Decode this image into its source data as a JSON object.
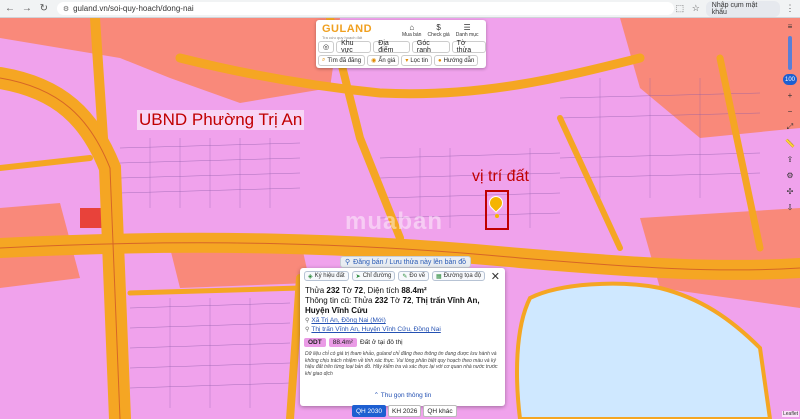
{
  "browser": {
    "url": "guland.vn/soi-quy-hoach/dong-nai",
    "translate_label": "Nhập cụm mật khẩu"
  },
  "app": {
    "logo": "GULAND",
    "logo_tagline": "Tra cứu quy hoạch đất",
    "top_tools": [
      {
        "label": "Mua bán",
        "icon": "home-icon"
      },
      {
        "label": "Check giá",
        "icon": "dollar-icon"
      },
      {
        "label": "Danh mục",
        "icon": "menu-icon"
      }
    ],
    "tabs": [
      "Khu vực",
      "Địa điểm",
      "Góc ranh",
      "Tờ thửa"
    ],
    "filters": [
      "Tìm đã đăng",
      "Ẩn giá",
      "Lọc tin",
      "Hướng dẫn"
    ]
  },
  "map": {
    "label_ubnd": "UBND Phường Trị An",
    "label_location": "vị trí đất",
    "watermark": "muaban",
    "zoom_badge": "100",
    "draw_button": "Đăng bán / Lưu thửa này lên bản đồ",
    "colors": {
      "residential": "#f0a2ec",
      "road": "#f5a623",
      "public": "#f9897a",
      "water": "#cfe8ff"
    }
  },
  "info": {
    "chips": [
      "Ký hiệu đất",
      "Chỉ đường",
      "Đo vẽ",
      "Đường tọa độ"
    ],
    "thua_label": "Thửa",
    "thua_value": "232",
    "to_label": "Tờ",
    "to_value": "72",
    "area_label": "Diện tích",
    "area_value": "88.4m²",
    "old_info_prefix": "Thông tin cũ: Thửa",
    "old_thua": "232",
    "old_to_label": "Tờ",
    "old_to": "72",
    "old_place": "Thị trấn Vĩnh An, Huyện Vĩnh Cửu",
    "address_new": "Xã Trị An, Đồng Nai (Mới)",
    "address_old": "Thị trấn Vĩnh An, Huyện Vĩnh Cửu, Đồng Nai",
    "land_code": "ODT",
    "land_area": "88.4m²",
    "land_desc": "Đất ở tại đô thị",
    "disclaimer": "Dữ liệu chỉ có giá trị tham khảo, guland chỉ đăng theo thông tin đang được lưu hành và không chịu trách nhiệm về tính xác thực. Vui lòng phân biệt quy hoạch theo màu và ký hiệu đất trên từng loại bản đồ. Hãy kiểm tra và xác thực lại với cơ quan nhà nước trước khi giao dịch",
    "collapse": "Thu gọn thông tin"
  },
  "plans": [
    {
      "label": "QH 2030",
      "active": true
    },
    {
      "label": "KH 2026",
      "active": false
    },
    {
      "label": "QH khác",
      "active": false
    }
  ],
  "attribution": "Leaflet"
}
